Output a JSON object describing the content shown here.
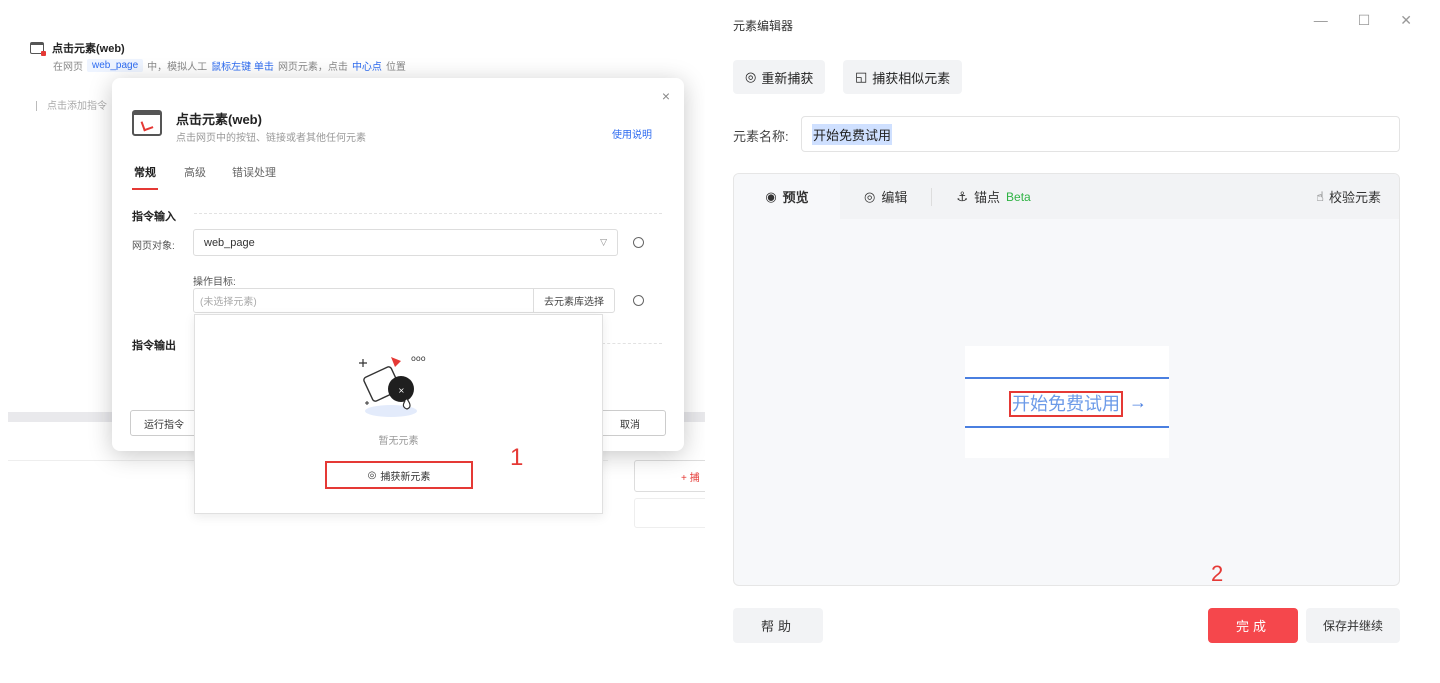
{
  "left": {
    "command": {
      "title": "点击元素(web)",
      "desc_prefix": "在网页",
      "desc_tag": "web_page",
      "desc_mid1": "中，模拟人工",
      "desc_action": "鼠标左键 单击",
      "desc_mid2": "网页元素，点击",
      "desc_pos": "中心点",
      "desc_suffix": "位置"
    },
    "add_command": "点击添加指令",
    "dialog": {
      "title": "点击元素(web)",
      "subtitle": "点击网页中的按钮、链接或者其他任何元素",
      "help_link": "使用说明",
      "close": "×",
      "tabs": [
        "常规",
        "高级",
        "错误处理"
      ],
      "section_input": "指令输入",
      "web_object_label": "网页对象:",
      "web_object_value": "web_page",
      "op_target_label": "操作目标:",
      "op_target_placeholder": "(未选择元素)",
      "from_library": "去元素库选择",
      "section_output": "指令输出",
      "run_button": "运行指令",
      "cancel_button": "取消"
    },
    "popover": {
      "empty_text": "暂无元素",
      "capture_new": "捕获新元素"
    },
    "annotation": "1",
    "stub_text": "+ 捕"
  },
  "right": {
    "window_title": "元素编辑器",
    "win_controls": [
      "—",
      "☐",
      "✕"
    ],
    "recapture": "重新捕获",
    "capture_similar": "捕获相似元素",
    "name_label": "元素名称:",
    "name_value": "开始免费试用",
    "tabs": {
      "preview": "预览",
      "edit": "编辑",
      "anchor": "锚点",
      "beta": "Beta",
      "verify": "校验元素"
    },
    "preview_button_text": "开始免费试用",
    "annotation": "2",
    "help": "帮助",
    "done": "完成",
    "save_continue": "保存并继续"
  },
  "colors": {
    "accent_red": "#f5474c",
    "link_blue": "#2d6bf0",
    "beta_green": "#2fb344"
  }
}
